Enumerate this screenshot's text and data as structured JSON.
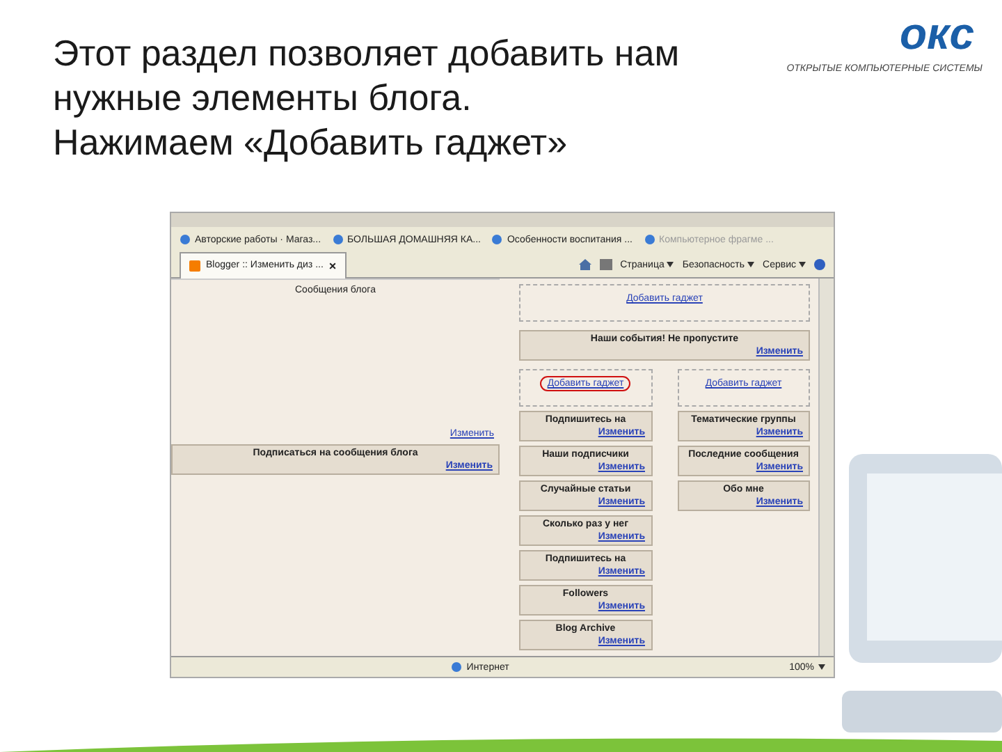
{
  "slide": {
    "title": [
      "Этот раздел позволяет добавить нам",
      "нужные элементы блога.",
      "Нажимаем «Добавить гаджет»"
    ],
    "logo": {
      "mark": "окс",
      "tagline": "ОТКРЫТЫЕ КОМПЬЮТЕРНЫЕ СИСТЕМЫ"
    }
  },
  "browser": {
    "favorites": [
      {
        "label": "Авторские работы · Магаз...",
        "disabled": false
      },
      {
        "label": "БОЛЬШАЯ ДОМАШНЯЯ КА...",
        "disabled": false
      },
      {
        "label": "Особенности воспитания ...",
        "disabled": false
      },
      {
        "label": "Компьютерное фрагме ...",
        "disabled": true
      }
    ],
    "tabs": [
      {
        "label": "Blogger :: Изменить диз ...",
        "close": "×",
        "selected": true
      }
    ],
    "menus": [
      "Страница",
      "Безопасность",
      "Сервис"
    ],
    "left": {
      "title": "Сообщения блога",
      "edit": "Изменить",
      "gadgets": [
        {
          "title": "Подписаться на сообщения блога",
          "edit": "Изменить"
        }
      ]
    },
    "right": {
      "add": "Добавить гаджет",
      "gadgets": [
        {
          "title": "Наши события! Не пропустите",
          "edit": "Изменить"
        }
      ],
      "columns": [
        {
          "add": "Добавить гаджет",
          "highlighted": true,
          "gadgets": [
            {
              "title": "Подпишитесь на",
              "edit": "Изменить"
            },
            {
              "title": "Наши подписчики",
              "edit": "Изменить"
            },
            {
              "title": "Случайные статьи",
              "edit": "Изменить"
            },
            {
              "title": "Сколько раз у нег",
              "edit": "Изменить"
            },
            {
              "title": "Подпишитесь на",
              "edit": "Изменить"
            },
            {
              "title": "Followers",
              "edit": "Изменить"
            },
            {
              "title": "Blog Archive",
              "edit": "Изменить"
            }
          ]
        },
        {
          "add": "Добавить гаджет",
          "highlighted": false,
          "gadgets": [
            {
              "title": "Тематические группы",
              "edit": "Изменить"
            },
            {
              "title": "Последние сообщения",
              "edit": "Изменить"
            },
            {
              "title": "Обо мне",
              "edit": "Изменить"
            }
          ]
        }
      ]
    },
    "status": {
      "zone": "Интернет",
      "zoom": "100%"
    }
  }
}
